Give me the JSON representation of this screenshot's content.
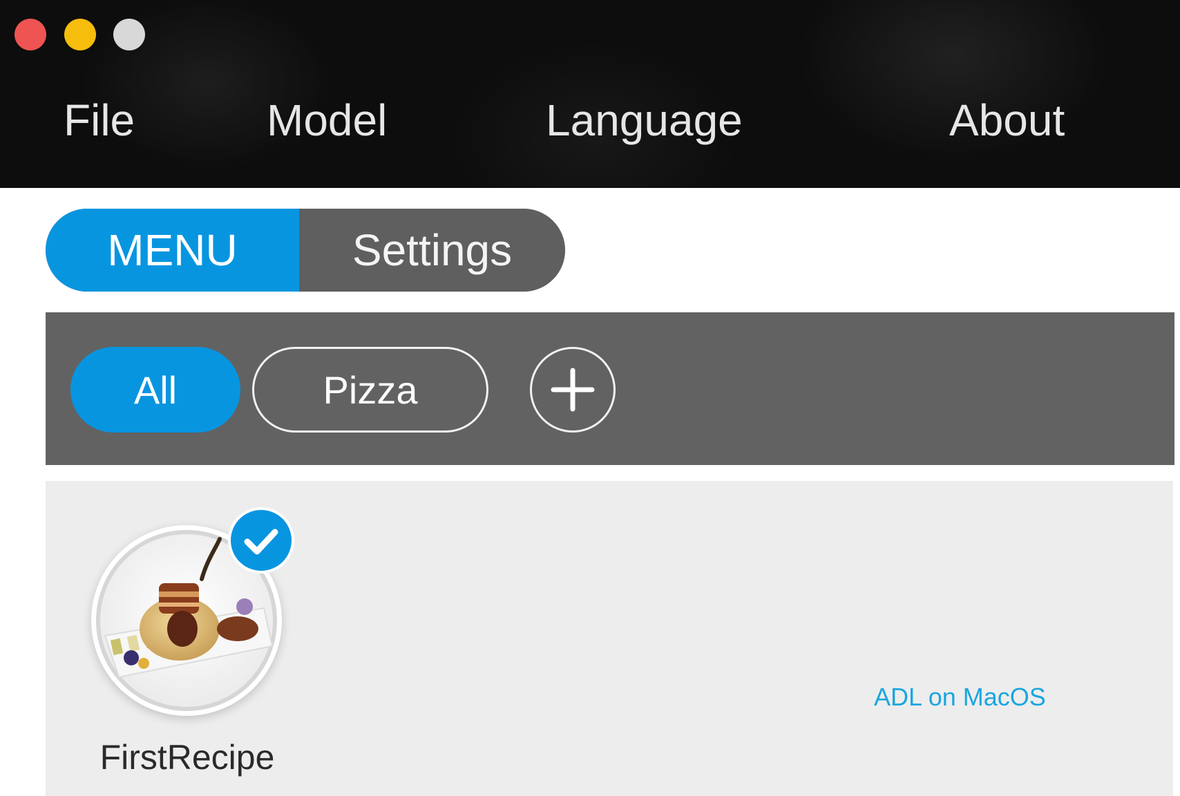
{
  "window": {
    "traffic_lights": {
      "close_color": "#ee5452",
      "minimize_color": "#f6bd0c",
      "zoom_color": "#d8d8d8"
    }
  },
  "menubar": {
    "items": [
      {
        "label": "File"
      },
      {
        "label": "Model"
      },
      {
        "label": "Language"
      },
      {
        "label": "About"
      }
    ]
  },
  "main_tabs": {
    "active": "MENU",
    "items": [
      {
        "label": "MENU"
      },
      {
        "label": "Settings"
      }
    ]
  },
  "categories": {
    "active": "All",
    "items": [
      {
        "label": "All"
      },
      {
        "label": "Pizza"
      }
    ],
    "add_icon": "plus-icon"
  },
  "recipes": [
    {
      "name": "FirstRecipe",
      "selected": true,
      "selected_icon": "checkmark-icon"
    }
  ],
  "footer_note": "ADL on MacOS",
  "colors": {
    "accent": "#0895e0",
    "titlebar_bg": "#0d0d0d",
    "category_bar_bg": "#626262",
    "content_bg": "#ededed",
    "footer_note": "#1aa6e0"
  }
}
